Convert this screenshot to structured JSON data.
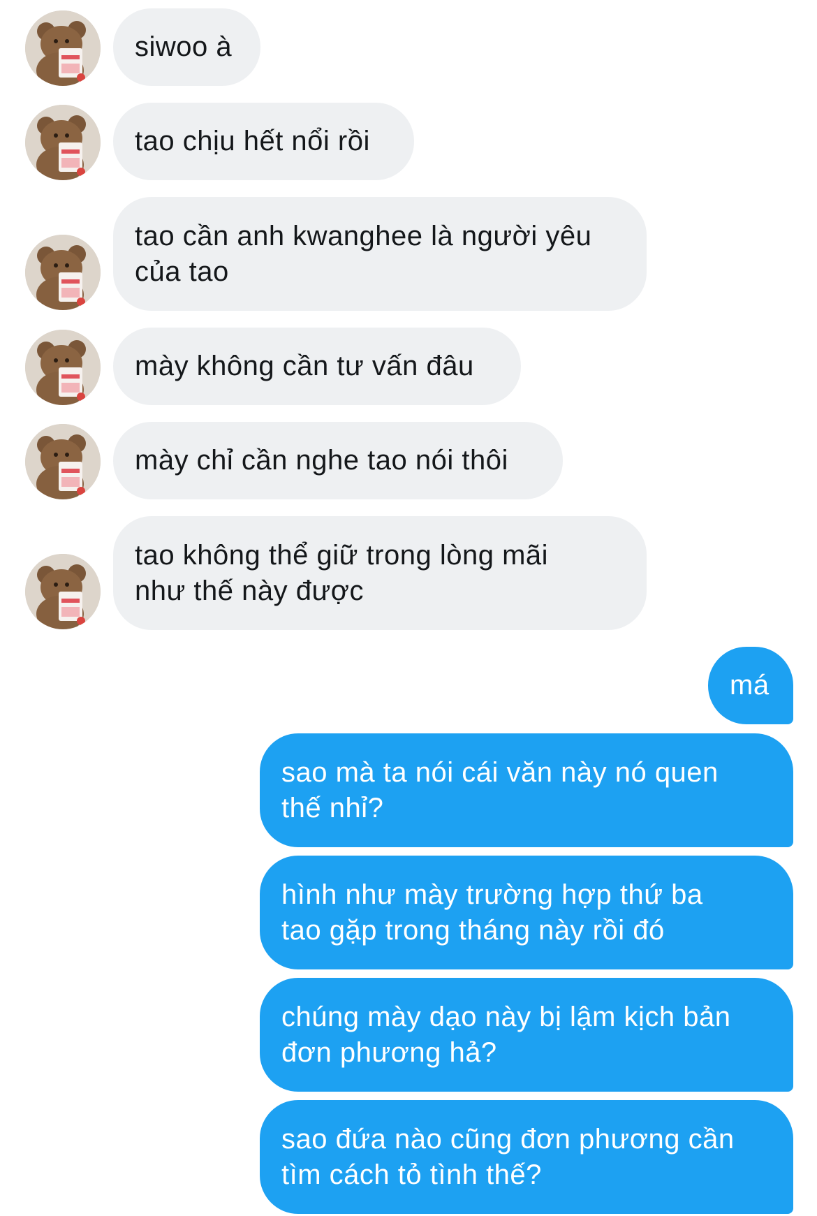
{
  "conversation": {
    "incoming_avatar_icon": "teddy-bear-avatar",
    "colors": {
      "incoming_bubble": "#eef0f2",
      "incoming_text": "#14171a",
      "outgoing_bubble": "#1da1f2",
      "outgoing_text": "#ffffff"
    },
    "messages": [
      {
        "direction": "incoming",
        "text": "siwoo à"
      },
      {
        "direction": "incoming",
        "text": "tao chịu hết nổi rồi"
      },
      {
        "direction": "incoming",
        "text": "tao cần anh kwanghee là người yêu\ncủa tao"
      },
      {
        "direction": "incoming",
        "text": "mày không cần tư vấn đâu"
      },
      {
        "direction": "incoming",
        "text": "mày chỉ cần nghe tao nói thôi"
      },
      {
        "direction": "incoming",
        "text": "tao không thể giữ trong lòng mãi\nnhư thế này được"
      },
      {
        "direction": "outgoing",
        "text": "má"
      },
      {
        "direction": "outgoing",
        "text": "sao mà ta nói cái văn này nó quen\nthế nhỉ?"
      },
      {
        "direction": "outgoing",
        "text": "hình như mày trường hợp thứ ba\ntao gặp trong tháng này rồi đó"
      },
      {
        "direction": "outgoing",
        "text": "chúng mày dạo này bị lậm kịch bản\nđơn phương hả?"
      },
      {
        "direction": "outgoing",
        "text": "sao đứa nào cũng đơn phương cần\ntìm cách tỏ tình thế?"
      }
    ]
  }
}
